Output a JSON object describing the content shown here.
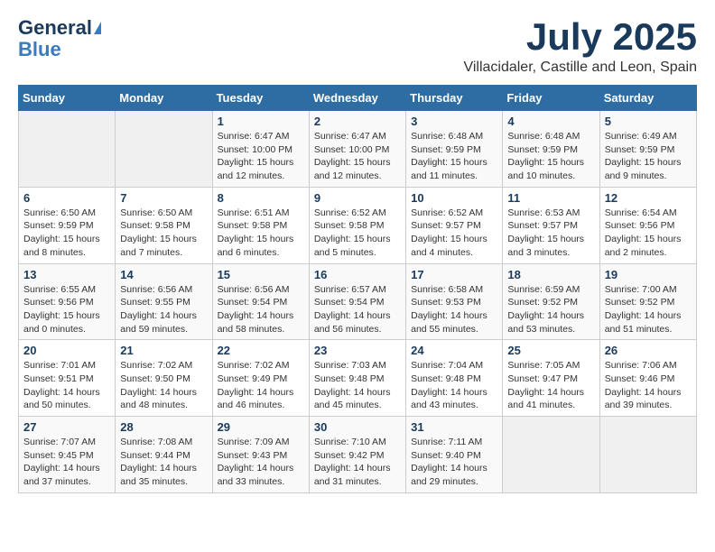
{
  "header": {
    "logo_general": "General",
    "logo_blue": "Blue",
    "month_title": "July 2025",
    "location": "Villacidaler, Castille and Leon, Spain"
  },
  "calendar": {
    "weekdays": [
      "Sunday",
      "Monday",
      "Tuesday",
      "Wednesday",
      "Thursday",
      "Friday",
      "Saturday"
    ],
    "weeks": [
      [
        {
          "day": "",
          "empty": true
        },
        {
          "day": "",
          "empty": true
        },
        {
          "day": "1",
          "sunrise": "6:47 AM",
          "sunset": "10:00 PM",
          "daylight": "15 hours and 12 minutes."
        },
        {
          "day": "2",
          "sunrise": "6:47 AM",
          "sunset": "10:00 PM",
          "daylight": "15 hours and 12 minutes."
        },
        {
          "day": "3",
          "sunrise": "6:48 AM",
          "sunset": "9:59 PM",
          "daylight": "15 hours and 11 minutes."
        },
        {
          "day": "4",
          "sunrise": "6:48 AM",
          "sunset": "9:59 PM",
          "daylight": "15 hours and 10 minutes."
        },
        {
          "day": "5",
          "sunrise": "6:49 AM",
          "sunset": "9:59 PM",
          "daylight": "15 hours and 9 minutes."
        }
      ],
      [
        {
          "day": "6",
          "sunrise": "6:50 AM",
          "sunset": "9:59 PM",
          "daylight": "15 hours and 8 minutes."
        },
        {
          "day": "7",
          "sunrise": "6:50 AM",
          "sunset": "9:58 PM",
          "daylight": "15 hours and 7 minutes."
        },
        {
          "day": "8",
          "sunrise": "6:51 AM",
          "sunset": "9:58 PM",
          "daylight": "15 hours and 6 minutes."
        },
        {
          "day": "9",
          "sunrise": "6:52 AM",
          "sunset": "9:58 PM",
          "daylight": "15 hours and 5 minutes."
        },
        {
          "day": "10",
          "sunrise": "6:52 AM",
          "sunset": "9:57 PM",
          "daylight": "15 hours and 4 minutes."
        },
        {
          "day": "11",
          "sunrise": "6:53 AM",
          "sunset": "9:57 PM",
          "daylight": "15 hours and 3 minutes."
        },
        {
          "day": "12",
          "sunrise": "6:54 AM",
          "sunset": "9:56 PM",
          "daylight": "15 hours and 2 minutes."
        }
      ],
      [
        {
          "day": "13",
          "sunrise": "6:55 AM",
          "sunset": "9:56 PM",
          "daylight": "15 hours and 0 minutes."
        },
        {
          "day": "14",
          "sunrise": "6:56 AM",
          "sunset": "9:55 PM",
          "daylight": "14 hours and 59 minutes."
        },
        {
          "day": "15",
          "sunrise": "6:56 AM",
          "sunset": "9:54 PM",
          "daylight": "14 hours and 58 minutes."
        },
        {
          "day": "16",
          "sunrise": "6:57 AM",
          "sunset": "9:54 PM",
          "daylight": "14 hours and 56 minutes."
        },
        {
          "day": "17",
          "sunrise": "6:58 AM",
          "sunset": "9:53 PM",
          "daylight": "14 hours and 55 minutes."
        },
        {
          "day": "18",
          "sunrise": "6:59 AM",
          "sunset": "9:52 PM",
          "daylight": "14 hours and 53 minutes."
        },
        {
          "day": "19",
          "sunrise": "7:00 AM",
          "sunset": "9:52 PM",
          "daylight": "14 hours and 51 minutes."
        }
      ],
      [
        {
          "day": "20",
          "sunrise": "7:01 AM",
          "sunset": "9:51 PM",
          "daylight": "14 hours and 50 minutes."
        },
        {
          "day": "21",
          "sunrise": "7:02 AM",
          "sunset": "9:50 PM",
          "daylight": "14 hours and 48 minutes."
        },
        {
          "day": "22",
          "sunrise": "7:02 AM",
          "sunset": "9:49 PM",
          "daylight": "14 hours and 46 minutes."
        },
        {
          "day": "23",
          "sunrise": "7:03 AM",
          "sunset": "9:48 PM",
          "daylight": "14 hours and 45 minutes."
        },
        {
          "day": "24",
          "sunrise": "7:04 AM",
          "sunset": "9:48 PM",
          "daylight": "14 hours and 43 minutes."
        },
        {
          "day": "25",
          "sunrise": "7:05 AM",
          "sunset": "9:47 PM",
          "daylight": "14 hours and 41 minutes."
        },
        {
          "day": "26",
          "sunrise": "7:06 AM",
          "sunset": "9:46 PM",
          "daylight": "14 hours and 39 minutes."
        }
      ],
      [
        {
          "day": "27",
          "sunrise": "7:07 AM",
          "sunset": "9:45 PM",
          "daylight": "14 hours and 37 minutes."
        },
        {
          "day": "28",
          "sunrise": "7:08 AM",
          "sunset": "9:44 PM",
          "daylight": "14 hours and 35 minutes."
        },
        {
          "day": "29",
          "sunrise": "7:09 AM",
          "sunset": "9:43 PM",
          "daylight": "14 hours and 33 minutes."
        },
        {
          "day": "30",
          "sunrise": "7:10 AM",
          "sunset": "9:42 PM",
          "daylight": "14 hours and 31 minutes."
        },
        {
          "day": "31",
          "sunrise": "7:11 AM",
          "sunset": "9:40 PM",
          "daylight": "14 hours and 29 minutes."
        },
        {
          "day": "",
          "empty": true
        },
        {
          "day": "",
          "empty": true
        }
      ]
    ]
  }
}
